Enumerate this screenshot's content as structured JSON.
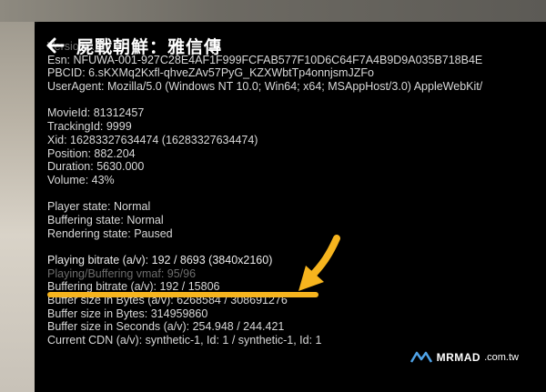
{
  "window": {
    "title": "屍戰朝鮮：雅信傳"
  },
  "debug": {
    "lines": [
      "Version: ...",
      "Esn: NFUWA-001-927C28E4AF1F999FCFAB577F10D6C64F7A4B9D9A035B718B4E",
      "PBCID: 6.sKXMq2Kxfl-qhveZAv57PyG_KZXWbtTp4onnjsmJZFo",
      "UserAgent: Mozilla/5.0 (Windows NT 10.0; Win64; x64; MSAppHost/3.0) AppleWebKit/",
      "",
      "MovieId: 81312457",
      "TrackingId: 9999",
      "Xid: 16283327634474 (16283327634474)",
      "Position: 882.204",
      "Duration: 5630.000",
      "Volume: 43%",
      "",
      "Player state: Normal",
      "Buffering state: Normal",
      "Rendering state: Paused",
      "",
      "Playing bitrate (a/v): 192 / 8693 (3840x2160)",
      "Playing/Buffering vmaf: 95/96",
      "Buffering bitrate (a/v): 192 / 15806",
      "Buffer size in Bytes (a/v): 6268584 / 308691276",
      "Buffer size in Bytes: 314959860",
      "Buffer size in Seconds (a/v): 254.948 / 244.421",
      "Current CDN (a/v): synthetic-1, Id: 1 / synthetic-1, Id: 1"
    ]
  },
  "watermark": {
    "brand": "MRMAD",
    "domain": ".com.tw"
  },
  "colors": {
    "highlight": "#f6b41e",
    "text": "#d8d8d8",
    "background": "#000000"
  },
  "icons": {
    "back": "arrow-left-icon",
    "pointer": "arrow-pointer-icon",
    "logo": "mrmad-logo-icon"
  }
}
